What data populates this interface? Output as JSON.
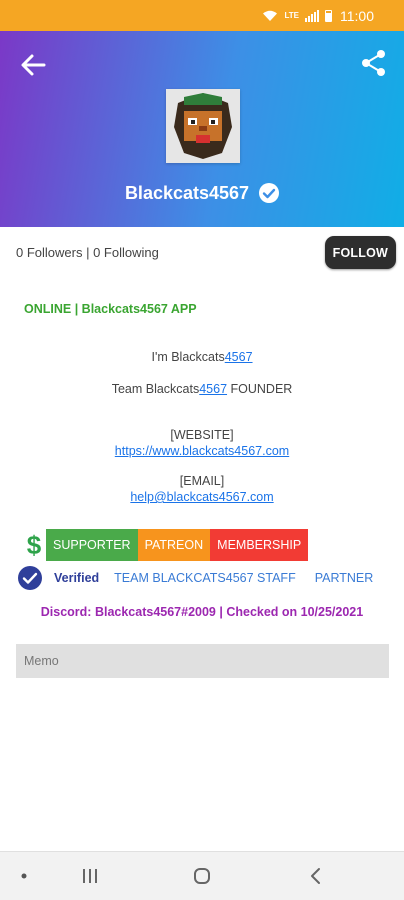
{
  "status_bar": {
    "time": "11:00",
    "network": "LTE"
  },
  "profile": {
    "name": "Blackcats4567",
    "followers_text": "0 Followers | 0 Following",
    "follow_label": "FOLLOW",
    "online_status": "ONLINE | Blackcats4567 APP"
  },
  "bio": {
    "line1_prefix": "I'm Blackcats",
    "line1_link": "4567",
    "line2_prefix": "Team Blackcats",
    "line2_link": "4567",
    "line2_suffix": " FOUNDER",
    "website_header": "[WEBSITE]",
    "website_url": "https://www.blackcats4567.com",
    "email_header": "[EMAIL]",
    "email": "help@blackcats4567.com"
  },
  "tags": {
    "supporter": "SUPPORTER",
    "patreon": "PATREON",
    "membership": "MEMBERSHIP"
  },
  "roles": {
    "verified": "Verified",
    "staff": "TEAM BLACKCATS4567 STAFF",
    "partner": "PARTNER"
  },
  "discord_line": "Discord: Blackcats4567#2009 | Checked on 10/25/2021",
  "memo": {
    "placeholder": "Memo"
  },
  "colors": {
    "status_bar": "#f5a623",
    "header_gradient_start": "#7b38c7",
    "header_gradient_end": "#10aee6",
    "online_green": "#3aa531",
    "supporter": "#4aaa4a",
    "patreon": "#f7941d",
    "membership": "#f23b34",
    "verified_blue": "#2f3f9a",
    "discord_purple": "#9c27b0"
  },
  "icons": {
    "back": "arrow-left-icon",
    "share": "share-icon",
    "verified": "check-circle-icon",
    "dollar": "dollar-icon",
    "nav_recents": "recents-icon",
    "nav_home": "home-icon",
    "nav_back": "nav-back-icon"
  }
}
